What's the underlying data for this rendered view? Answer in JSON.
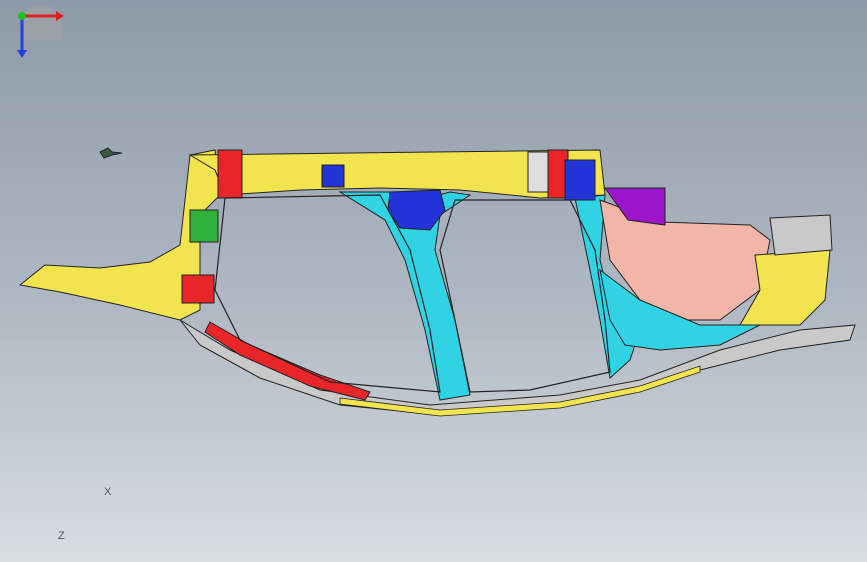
{
  "colors": {
    "frame_yellow": "#f2e44e",
    "frame_cyan": "#2fd3e4",
    "frame_red": "#e8262a",
    "frame_blue": "#2233d8",
    "frame_pink": "#f2b6a8",
    "frame_purple": "#9a16c8",
    "frame_green": "#2fb23a",
    "frame_grey": "#c9c9c9",
    "axis_x": "#e02020",
    "axis_y": "#20c020",
    "axis_z": "#2040e0"
  },
  "icons": {
    "view_orientation": "triad-icon",
    "cursor": "mouse-cursor-icon"
  },
  "triad": {
    "x_label": "X",
    "z_label": "Z"
  }
}
